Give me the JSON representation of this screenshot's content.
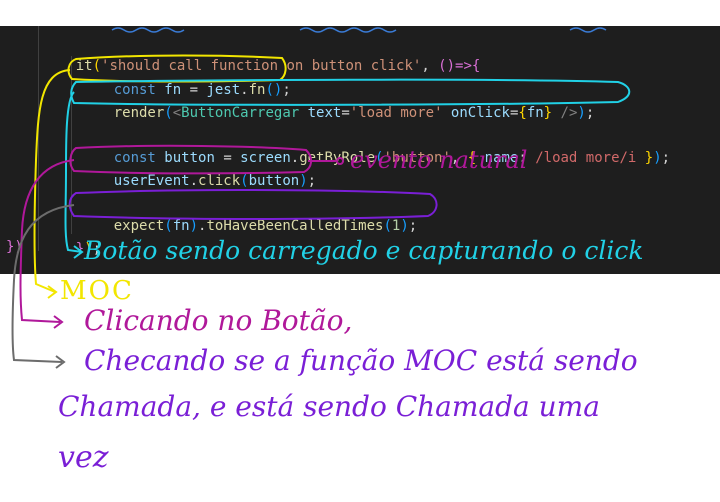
{
  "code": {
    "line_it": {
      "kw": "it",
      "open": "(",
      "str": "'should call function on button click'",
      "comma": ", ",
      "arrow": "()=>",
      "brace": "{"
    },
    "line_const_fn": {
      "kw": "const",
      "name": " fn ",
      "eq": "= ",
      "obj": "jest",
      "dot": ".",
      "call": "fn",
      "parens": "()",
      "semi": ";"
    },
    "line_render": {
      "fn": "render",
      "open": "(",
      "lt": "<",
      "comp": "ButtonCarregar",
      "attr1": " text",
      "eq1": "=",
      "val1": "'load more'",
      "attr2": " onClick",
      "eq2": "=",
      "val2_open": "{",
      "val2": "fn",
      "val2_close": "}",
      "selfclose": " />",
      "close": ")",
      "semi": ";"
    },
    "line_const_button": {
      "kw": "const",
      "name": " button ",
      "eq": "= ",
      "obj": "screen",
      "dot": ".",
      "call": "getByRole",
      "open": "(",
      "str": "'button'",
      "comma": ", ",
      "ob": "{ ",
      "key": "name",
      "colon": ": ",
      "rx": "/load more/i",
      "cb": " }",
      "close": ")",
      "semi": ";"
    },
    "line_user_event": {
      "obj": "userEvent",
      "dot": ".",
      "call": "click",
      "open": "(",
      "arg": "button",
      "close": ")",
      "semi": ";"
    },
    "line_expect": {
      "call": "expect",
      "open": "(",
      "arg": "fn",
      "close": ")",
      "dot": ".",
      "matcher": "toHaveBeenCalledTimes",
      "open2": "(",
      "num": "1",
      "close2": ")",
      "semi": ";"
    },
    "line_close_inner": {
      "brace": "}",
      "paren": ")",
      "semi": ";"
    },
    "line_close_outer": {
      "brace": "})"
    }
  },
  "annotations": {
    "evento_natural": "evento natural",
    "botao_carregado": "Botão sendo carregado e capturando o click",
    "moc": "MOC",
    "clicando": "Clicando no Botão,",
    "checando_1": "Checando se a função MOC está sendo",
    "checando_2": "Chamada, e está sendo Chamada uma",
    "checando_3": "vez"
  },
  "colors": {
    "editor_bg": "#1e1e1e",
    "annot_yellow": "#f2e600",
    "annot_magenta": "#b0189a",
    "annot_purple": "#7a1fd6",
    "annot_cyan": "#21d1e6",
    "annot_gray": "#6c6c6c"
  }
}
